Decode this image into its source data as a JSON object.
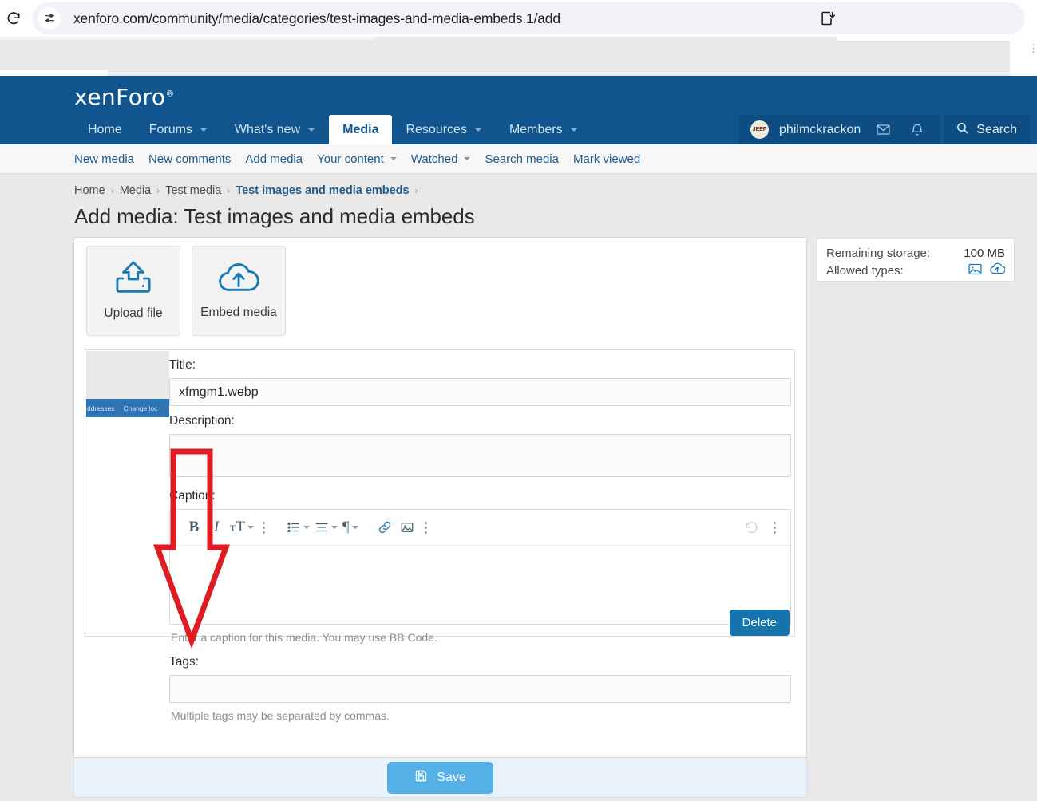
{
  "browser": {
    "url": "xenforo.com/community/media/categories/test-images-and-media-embeds.1/add",
    "reload_icon": "reload-icon",
    "site_info_icon": "site-settings-icon",
    "install_icon": "install-app-icon"
  },
  "header": {
    "logo": "xenForo",
    "logo_tm": "®",
    "nav": [
      {
        "label": "Home",
        "has_caret": false,
        "active": false
      },
      {
        "label": "Forums",
        "has_caret": true,
        "active": false
      },
      {
        "label": "What's new",
        "has_caret": true,
        "active": false
      },
      {
        "label": "Media",
        "has_caret": false,
        "active": true
      },
      {
        "label": "Resources",
        "has_caret": true,
        "active": false
      },
      {
        "label": "Members",
        "has_caret": true,
        "active": false
      }
    ],
    "user": {
      "name": "philmckrackon",
      "avatar_text": "JEEP",
      "inbox_icon": "envelope-icon",
      "alerts_icon": "bell-icon"
    },
    "search": {
      "label": "Search",
      "icon": "search-icon"
    }
  },
  "subnav": [
    {
      "label": "New media",
      "has_caret": false
    },
    {
      "label": "New comments",
      "has_caret": false
    },
    {
      "label": "Add media",
      "has_caret": false
    },
    {
      "label": "Your content",
      "has_caret": true
    },
    {
      "label": "Watched",
      "has_caret": true
    },
    {
      "label": "Search media",
      "has_caret": false
    },
    {
      "label": "Mark viewed",
      "has_caret": false
    }
  ],
  "breadcrumb": [
    {
      "label": "Home",
      "current": false
    },
    {
      "label": "Media",
      "current": false
    },
    {
      "label": "Test media",
      "current": false
    },
    {
      "label": "Test images and media embeds",
      "current": true
    }
  ],
  "page_title": "Add media: Test images and media embeds",
  "uploader": {
    "upload_file": {
      "label": "Upload file",
      "icon": "upload-tray-icon"
    },
    "embed_media": {
      "label": "Embed media",
      "icon": "cloud-upload-icon"
    }
  },
  "attachment": {
    "thumbnail": {
      "bar_text_1": "ddresses",
      "bar_text_2": "Change loc"
    },
    "title": {
      "label": "Title:",
      "value": "xfmgm1.webp"
    },
    "description": {
      "label": "Description:",
      "value": ""
    },
    "caption": {
      "label": "Caption:",
      "value": "",
      "hint": "Enter a caption for this media. You may use BB Code."
    },
    "tags": {
      "label": "Tags:",
      "value": "",
      "hint": "Multiple tags may be separated by commas."
    },
    "delete_label": "Delete"
  },
  "editor_toolbar": {
    "bold": {
      "label": "B",
      "icon": "bold-icon"
    },
    "italic": {
      "label": "I",
      "icon": "italic-icon"
    },
    "font_size": {
      "label": "TT",
      "icon": "font-size-icon"
    },
    "more_text": "more-text-options-icon",
    "list": "bulleted-list-icon",
    "align": "text-align-icon",
    "paragraph": {
      "label": "¶",
      "icon": "paragraph-icon"
    },
    "link": "link-icon",
    "image": "insert-image-icon",
    "more_insert": "more-insert-options-icon",
    "undo": "undo-icon",
    "overflow": "toolbar-overflow-icon"
  },
  "sidebar": {
    "remaining_storage_label": "Remaining storage:",
    "remaining_storage_value": "100 MB",
    "allowed_types_label": "Allowed types:",
    "allowed_types_icons": [
      "image-type-icon",
      "cloud-embed-icon"
    ]
  },
  "save_button": {
    "label": "Save",
    "icon": "floppy-save-icon"
  },
  "annotation": {
    "type": "down-arrow",
    "color": "#e01b22"
  },
  "colors": {
    "header_blue": "#10558d",
    "accent_link": "#1e5b8d",
    "delete_blue": "#1474ab",
    "save_blue": "#56b0e8",
    "annotation_red": "#e01b22"
  }
}
